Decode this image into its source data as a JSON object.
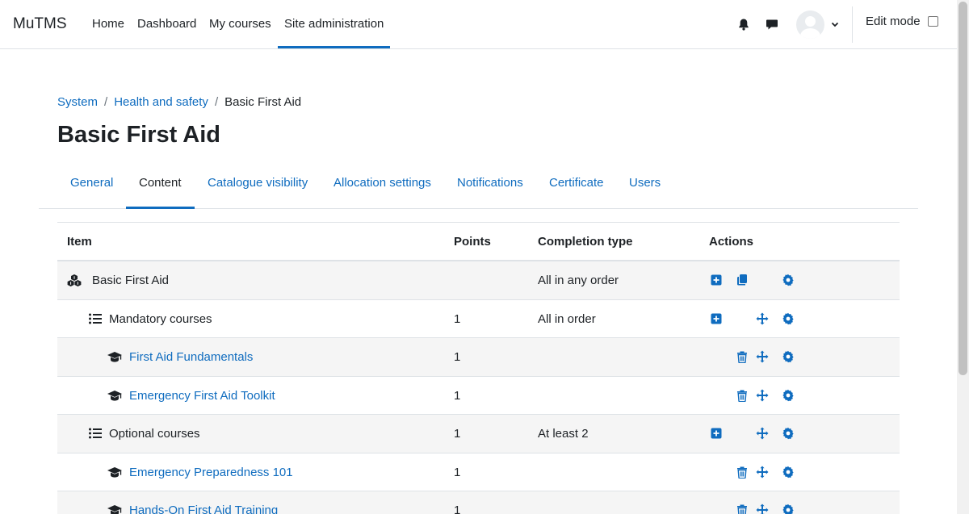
{
  "navbar": {
    "brand": "MuTMS",
    "links": [
      {
        "label": "Home"
      },
      {
        "label": "Dashboard"
      },
      {
        "label": "My courses"
      },
      {
        "label": "Site administration"
      }
    ],
    "edit_mode_label": "Edit mode",
    "edit_mode_checked": false
  },
  "breadcrumb": {
    "items": [
      "System",
      "Health and safety",
      "Basic First Aid"
    ]
  },
  "page_title": "Basic First Aid",
  "tabs": [
    {
      "label": "General"
    },
    {
      "label": "Content",
      "active": true
    },
    {
      "label": "Catalogue visibility"
    },
    {
      "label": "Allocation settings"
    },
    {
      "label": "Notifications"
    },
    {
      "label": "Certificate"
    },
    {
      "label": "Users"
    }
  ],
  "table": {
    "headers": {
      "item": "Item",
      "points": "Points",
      "completion": "Completion type",
      "actions": "Actions"
    },
    "rows": [
      {
        "item": "Basic First Aid",
        "icon": "program-icon",
        "points": "",
        "completion": "All in any order",
        "actions": [
          "add",
          "duplicate",
          "settings"
        ]
      },
      {
        "item": "Mandatory courses",
        "icon": "list-icon",
        "points": "1",
        "completion": "All in order",
        "actions": [
          "add",
          "move",
          "settings"
        ]
      },
      {
        "item": "First Aid Fundamentals",
        "icon": "course-icon",
        "points": "1",
        "completion": "",
        "actions": [
          "delete",
          "move",
          "settings"
        ]
      },
      {
        "item": "Emergency First Aid Toolkit",
        "icon": "course-icon",
        "points": "1",
        "completion": "",
        "actions": [
          "delete",
          "move",
          "settings"
        ]
      },
      {
        "item": "Optional courses",
        "icon": "list-icon",
        "points": "1",
        "completion": "At least 2",
        "actions": [
          "add",
          "move",
          "settings"
        ]
      },
      {
        "item": "Emergency Preparedness 101",
        "icon": "course-icon",
        "points": "1",
        "completion": "",
        "actions": [
          "delete",
          "move",
          "settings"
        ]
      },
      {
        "item": "Hands-On First Aid Training",
        "icon": "course-icon",
        "points": "1",
        "completion": "",
        "actions": [
          "delete",
          "move",
          "settings"
        ]
      }
    ]
  },
  "colors": {
    "link": "#0f6cbf",
    "text": "#1d2125",
    "border": "#dee2e6",
    "stripe": "#f5f5f5"
  }
}
